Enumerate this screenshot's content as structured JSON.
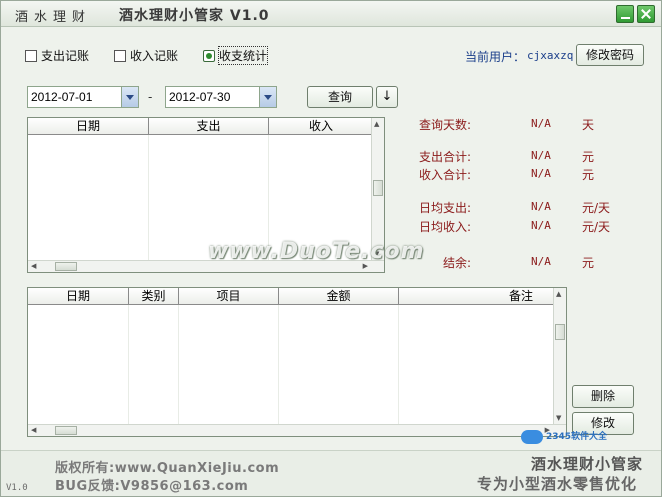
{
  "window": {
    "left_title": "酒水理财",
    "title": "酒水理财小管家 V1.0"
  },
  "modes": [
    {
      "label": "支出记账",
      "checked": false
    },
    {
      "label": "收入记账",
      "checked": false
    },
    {
      "label": "收支统计",
      "checked": true
    }
  ],
  "user": {
    "label": "当前用户：",
    "name": "cjxaxzq",
    "change_password_label": "修改密码"
  },
  "filter": {
    "start_date": "2012-07-01",
    "separator": "-",
    "end_date": "2012-07-30",
    "query_label": "查询",
    "sort_label": "↓"
  },
  "summary_table": {
    "columns": [
      "日期",
      "支出",
      "收入"
    ],
    "rows": []
  },
  "stats": [
    {
      "label": "查询天数:",
      "value": "N/A",
      "unit": "天"
    },
    {
      "label": "支出合计:",
      "value": "N/A",
      "unit": "元"
    },
    {
      "label": "收入合计:",
      "value": "N/A",
      "unit": "元"
    },
    {
      "label": "日均支出:",
      "value": "N/A",
      "unit": "元/天"
    },
    {
      "label": "日均收入:",
      "value": "N/A",
      "unit": "元/天"
    },
    {
      "label": "结余:",
      "value": "N/A",
      "unit": "元"
    }
  ],
  "detail_table": {
    "columns": [
      "日期",
      "类别",
      "项目",
      "金额",
      "备注"
    ],
    "rows": []
  },
  "actions": {
    "delete_label": "删除",
    "edit_label": "修改"
  },
  "watermark": "www.DuoTe.com",
  "footer": {
    "version": "V1.0",
    "copyright": "版权所有:www.QuanXieJiu.com",
    "bug": "BUG反馈:V9856@163.com",
    "slogan_title": "酒水理财小管家",
    "slogan": "专为小型酒水零售优化",
    "site_logo": "2345软件大全"
  },
  "colors": {
    "accent_green": "#2f9a32",
    "stat_red": "#8b1a1a",
    "user_blue": "#1a3e8a"
  }
}
